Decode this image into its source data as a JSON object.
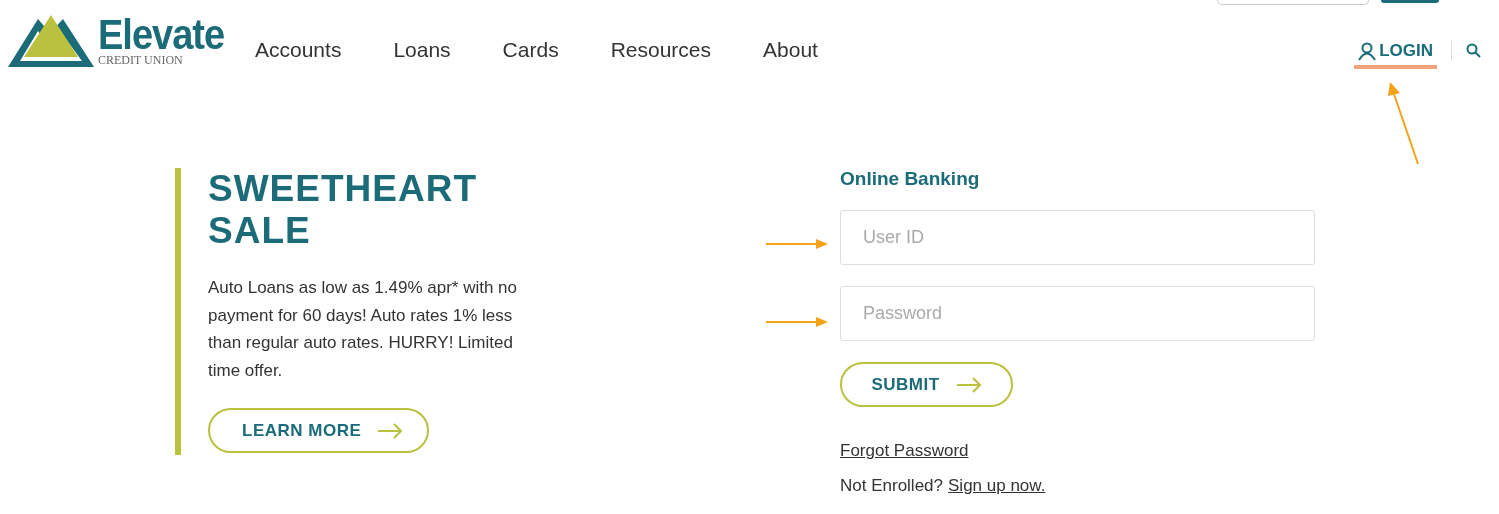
{
  "logo": {
    "name": "Elevate",
    "subtitle": "CREDIT UNION"
  },
  "nav": [
    "Accounts",
    "Loans",
    "Cards",
    "Resources",
    "About"
  ],
  "login": {
    "label": "LOGIN"
  },
  "promo": {
    "title": "SWEETHEART SALE",
    "body": "Auto Loans as low as 1.49% apr* with no payment for 60 days! Auto rates 1% less than regular auto rates. HURRY! Limited time offer.",
    "button": "LEARN MORE"
  },
  "login_form": {
    "title": "Online Banking",
    "fields": [
      {
        "placeholder": "User ID"
      },
      {
        "placeholder": "Password"
      }
    ],
    "submit": "SUBMIT",
    "forgot": "Forgot Password",
    "not_enrolled": "Not Enrolled?",
    "signup": "Sign up now."
  }
}
